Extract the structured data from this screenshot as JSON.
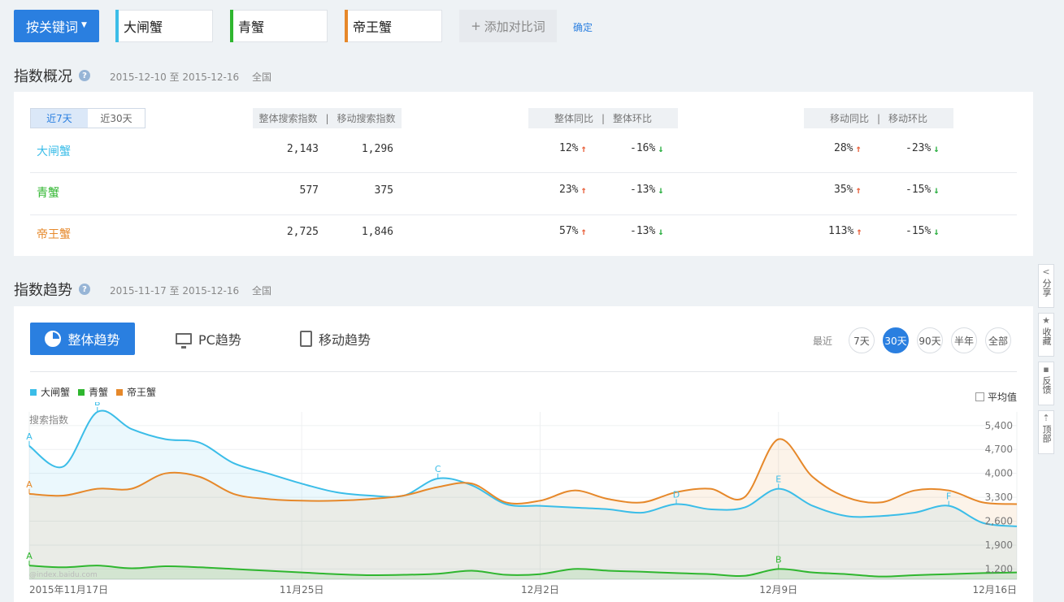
{
  "keywords": {
    "button_label": "按关键词",
    "items": [
      {
        "label": "大闸蟹",
        "color": "#3bbde8"
      },
      {
        "label": "青蟹",
        "color": "#2fb62f"
      },
      {
        "label": "帝王蟹",
        "color": "#e6882a"
      }
    ],
    "add_label": "添加对比词",
    "confirm_label": "确定"
  },
  "overview": {
    "title": "指数概况",
    "date_range": "2015-12-10 至 2015-12-16",
    "region": "全国",
    "periods": [
      "近7天",
      "近30天"
    ],
    "headers": {
      "overall_search": "整体搜索指数",
      "mobile_search": "移动搜索指数",
      "overall_yoy": "整体同比",
      "overall_mom": "整体环比",
      "mobile_yoy": "移动同比",
      "mobile_mom": "移动环比",
      "sep": "|"
    },
    "rows": [
      {
        "name": "大闸蟹",
        "overall": "2,143",
        "mobile": "1,296",
        "overall_yoy": "12%",
        "overall_mom": "-16%",
        "mobile_yoy": "28%",
        "mobile_mom": "-23%"
      },
      {
        "name": "青蟹",
        "overall": "577",
        "mobile": "375",
        "overall_yoy": "23%",
        "overall_mom": "-13%",
        "mobile_yoy": "35%",
        "mobile_mom": "-15%"
      },
      {
        "name": "帝王蟹",
        "overall": "2,725",
        "mobile": "1,846",
        "overall_yoy": "57%",
        "overall_mom": "-13%",
        "mobile_yoy": "113%",
        "mobile_mom": "-15%"
      }
    ]
  },
  "trend": {
    "title": "指数趋势",
    "date_range": "2015-11-17 至 2015-12-16",
    "region": "全国",
    "tabs": [
      "整体趋势",
      "PC趋势",
      "移动趋势"
    ],
    "range_label": "最近",
    "ranges": [
      "7天",
      "30天",
      "90天",
      "半年",
      "全部"
    ],
    "avg_label": "平均值",
    "watermark": "@index.baidu.com"
  },
  "side_tools": [
    "分享",
    "收藏",
    "反馈",
    "顶部"
  ],
  "chart_data": {
    "type": "area",
    "ylabel": "搜索指数",
    "yticks": [
      1200,
      1900,
      2600,
      3300,
      4000,
      4700,
      5400
    ],
    "ylim": [
      900,
      5800
    ],
    "xticks": [
      {
        "day": 0,
        "label": "2015年11月17日"
      },
      {
        "day": 8,
        "label": "11月25日"
      },
      {
        "day": 15,
        "label": "12月2日"
      },
      {
        "day": 22,
        "label": "12月9日"
      },
      {
        "day": 29,
        "label": "12月16日"
      }
    ],
    "series": [
      {
        "name": "大闸蟹",
        "color": "#3bbde8",
        "values": [
          4800,
          4200,
          5800,
          5300,
          5000,
          4900,
          4300,
          4000,
          3700,
          3450,
          3350,
          3350,
          3850,
          3650,
          3100,
          3050,
          3000,
          2950,
          2850,
          3100,
          2950,
          3000,
          3550,
          3050,
          2750,
          2750,
          2850,
          3050,
          2550,
          2450
        ]
      },
      {
        "name": "青蟹",
        "color": "#2fb62f",
        "values": [
          1300,
          1250,
          1300,
          1220,
          1280,
          1250,
          1200,
          1150,
          1100,
          1050,
          1020,
          1030,
          1060,
          1150,
          1030,
          1050,
          1200,
          1150,
          1120,
          1080,
          1050,
          1000,
          1200,
          1100,
          1050,
          980,
          1020,
          1050,
          1080,
          1100
        ]
      },
      {
        "name": "帝王蟹",
        "color": "#e6882a",
        "values": [
          3400,
          3350,
          3550,
          3550,
          4000,
          3900,
          3400,
          3250,
          3200,
          3200,
          3250,
          3350,
          3600,
          3700,
          3150,
          3200,
          3500,
          3250,
          3150,
          3450,
          3550,
          3300,
          5000,
          3900,
          3300,
          3150,
          3500,
          3500,
          3150,
          3100
        ]
      }
    ],
    "markers": [
      {
        "series": 0,
        "day": 0,
        "label": "A"
      },
      {
        "series": 0,
        "day": 2,
        "label": "B"
      },
      {
        "series": 0,
        "day": 12,
        "label": "C"
      },
      {
        "series": 0,
        "day": 19,
        "label": "D"
      },
      {
        "series": 0,
        "day": 22,
        "label": "E"
      },
      {
        "series": 0,
        "day": 27,
        "label": "F"
      },
      {
        "series": 2,
        "day": 0,
        "label": "A"
      },
      {
        "series": 1,
        "day": 0,
        "label": "A"
      },
      {
        "series": 1,
        "day": 22,
        "label": "B"
      }
    ]
  }
}
